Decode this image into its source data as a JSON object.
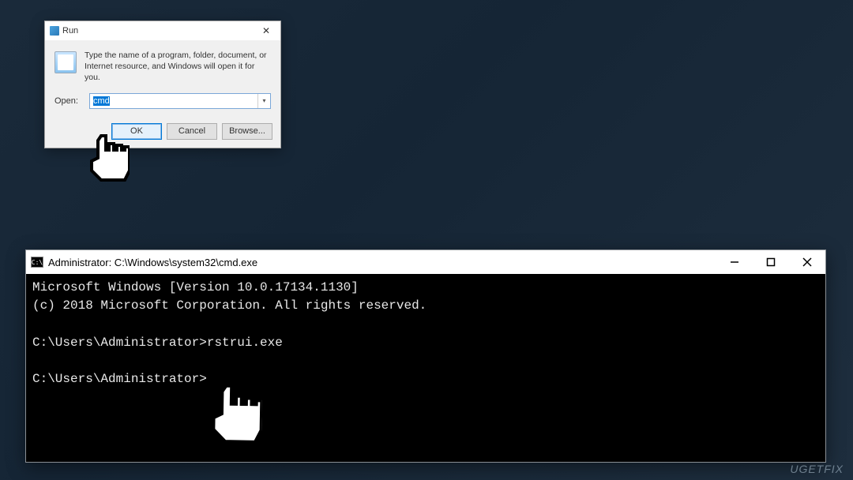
{
  "run_dialog": {
    "title": "Run",
    "description": "Type the name of a program, folder, document, or Internet resource, and Windows will open it for you.",
    "open_label": "Open:",
    "input_value": "cmd",
    "buttons": {
      "ok": "OK",
      "cancel": "Cancel",
      "browse": "Browse..."
    }
  },
  "cmd_window": {
    "title": "Administrator: C:\\Windows\\system32\\cmd.exe",
    "lines": {
      "l1": "Microsoft Windows [Version 10.0.17134.1130]",
      "l2": "(c) 2018 Microsoft Corporation. All rights reserved.",
      "l3": "",
      "l4": "C:\\Users\\Administrator>rstrui.exe",
      "l5": "",
      "l6": "C:\\Users\\Administrator>"
    }
  },
  "watermark": "UGETFIX"
}
